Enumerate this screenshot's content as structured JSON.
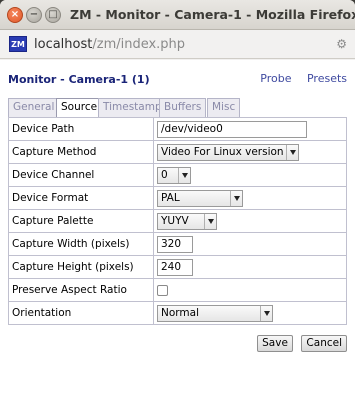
{
  "window": {
    "title": "ZM - Monitor - Camera-1 - Mozilla Firefox",
    "close_glyph": "×",
    "min_glyph": "−",
    "max_glyph": "□"
  },
  "urlbar": {
    "icon_label": "ZM",
    "host": "localhost",
    "path": "/zm/index.php"
  },
  "page": {
    "header": "Monitor - Camera-1 (1)",
    "links": {
      "probe": "Probe",
      "presets": "Presets"
    }
  },
  "tabs": [
    {
      "label": "General",
      "active": false
    },
    {
      "label": "Source",
      "active": true
    },
    {
      "label": "Timestamp",
      "active": false
    },
    {
      "label": "Buffers",
      "active": false
    },
    {
      "label": "Misc",
      "active": false
    }
  ],
  "form": {
    "device_path": {
      "label": "Device Path",
      "value": "/dev/video0"
    },
    "capture_method": {
      "label": "Capture Method",
      "value": "Video For Linux version 2"
    },
    "device_channel": {
      "label": "Device Channel",
      "value": "0"
    },
    "device_format": {
      "label": "Device Format",
      "value": "PAL"
    },
    "capture_palette": {
      "label": "Capture Palette",
      "value": "YUYV"
    },
    "capture_width": {
      "label": "Capture Width (pixels)",
      "value": "320"
    },
    "capture_height": {
      "label": "Capture Height (pixels)",
      "value": "240"
    },
    "preserve_aspect": {
      "label": "Preserve Aspect Ratio",
      "checked": false
    },
    "orientation": {
      "label": "Orientation",
      "value": "Normal"
    }
  },
  "buttons": {
    "save": "Save",
    "cancel": "Cancel"
  },
  "colors": {
    "header": "#1a2478",
    "link": "#3f4aa0",
    "close_button": "#e05a2b"
  },
  "icons": {
    "window_close": "close-icon",
    "window_min": "minimize-icon",
    "window_max": "maximize-icon",
    "settings": "gear-icon"
  }
}
